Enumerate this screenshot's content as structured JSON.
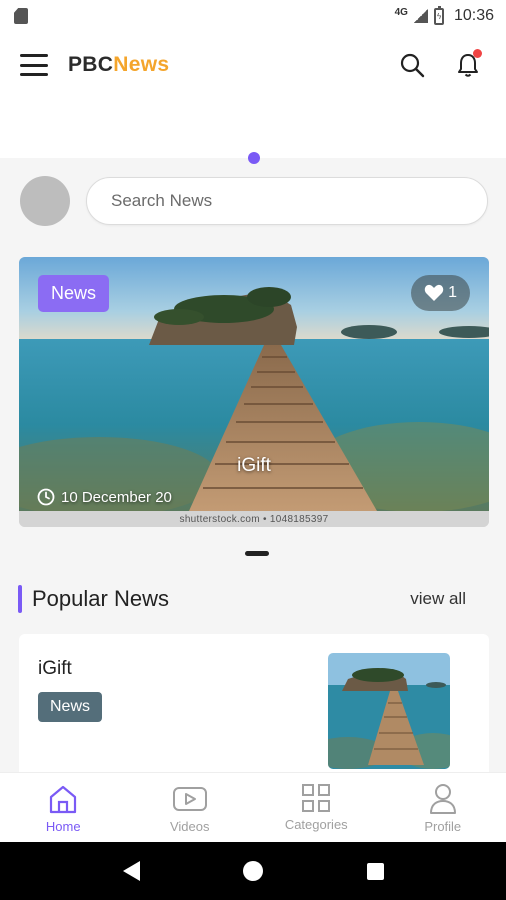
{
  "status_bar": {
    "network": "4G",
    "time": "10:36",
    "icons": [
      "sim-card-icon",
      "signal-icon",
      "battery-charging-icon"
    ]
  },
  "app_bar": {
    "brand_part1": "PBC",
    "brand_part2": "News",
    "icons": [
      "menu-icon",
      "search-icon",
      "bell-icon"
    ],
    "notification_dot_color": "#f04444"
  },
  "search": {
    "placeholder": "Search News",
    "value": ""
  },
  "hero": {
    "tag": "News",
    "likes": "1",
    "title": "iGift",
    "date": "10 December 20",
    "credit": "shutterstock.com • 1048185397"
  },
  "popular": {
    "title": "Popular News",
    "view_all": "view all",
    "items": [
      {
        "title": "iGift",
        "tag": "News"
      }
    ]
  },
  "bottom_nav": {
    "items": [
      {
        "label": "Home",
        "icon": "home-icon",
        "active": true
      },
      {
        "label": "Videos",
        "icon": "play-icon",
        "active": false
      },
      {
        "label": "Categories",
        "icon": "grid-icon",
        "active": false
      },
      {
        "label": "Profile",
        "icon": "user-icon",
        "active": false
      }
    ]
  },
  "colors": {
    "accent": "#7a5af5",
    "brand_orange": "#f4a52c",
    "tag_purple": "#8b6cf3",
    "tag_slate": "#546e7a"
  }
}
